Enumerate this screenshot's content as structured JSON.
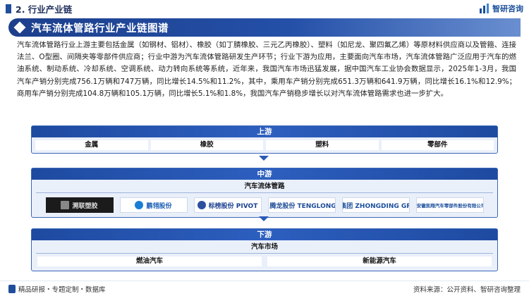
{
  "header": {
    "section_title": "2. 行业产业链",
    "logo_text": "智研咨询"
  },
  "banner": {
    "title": "汽车流体管路行业产业链图谱"
  },
  "paragraph": "汽车流体管路行业上游主要包括金属（如钢材、铝材）、橡胶（如丁腈橡胶、三元乙丙橡胶）、塑料（如尼龙、聚四氟乙烯）等原材料供应商以及管箍、连接法兰、O型圈、间隔夹等零部件供应商；行业中游为汽车流体管路研发生产环节；行业下游为应用，主要面向汽车市场，汽车流体管路广泛应用于汽车的燃油系统、制动系统、冷却系统、空调系统、动力转向系统等系统，近年来，我国汽车市场迅猛发展，据中国汽车工业协会数据显示，2025年1-3月，我国汽车产销分别完成756.1万辆和747万辆，同比增长14.5%和11.2%，其中，乘用车产销分别完成651.3万辆和641.9万辆，同比增长16.1%和12.9%；商用车产销分别完成104.8万辆和105.1万辆，同比增长5.1%和1.8%，我国汽车产销稳步增长以对汽车流体管路需求也进一步扩大。",
  "upstream": {
    "title": "上游",
    "items": [
      "金属",
      "橡胶",
      "塑料",
      "零部件"
    ]
  },
  "midstream": {
    "title": "中游",
    "subtitle": "汽车流体管路",
    "companies": [
      "溯联塑胶",
      "鹏翎股份",
      "标榜股份 PIVOT",
      "腾龙股份 TENGLONG",
      "中鼎集团 ZHONGDING GROUP",
      "安徽凯翔汽车零部件股份有限公司"
    ]
  },
  "downstream": {
    "title": "下游",
    "subtitle": "汽车市场",
    "items": [
      "燃油汽车",
      "新能源汽车"
    ]
  },
  "footer": {
    "left": "精品研报・专题定制・数据库",
    "right": "资料来源：公开资料、智研咨询整理"
  },
  "colors": {
    "brand_blue": "#1f4e9c",
    "banner_blue": "#2450a8",
    "tier_bg": "#eaf0fa"
  }
}
